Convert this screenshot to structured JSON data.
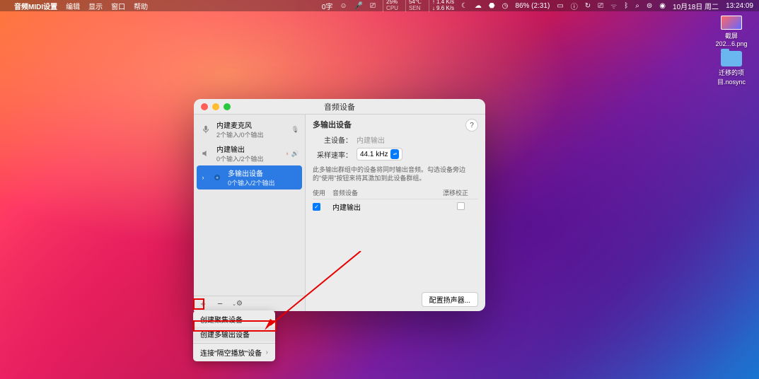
{
  "menubar": {
    "app_name": "音频MIDI设置",
    "items": [
      "编辑",
      "显示",
      "窗口",
      "帮助"
    ],
    "right": {
      "word_count": "0字",
      "cpu": {
        "pct": "25%",
        "label": "CPU"
      },
      "temp": {
        "value": "54℃",
        "label": "SEN"
      },
      "net": {
        "up": "↑ 1.4 K/s",
        "down": "↓ 9.6 K/s"
      },
      "battery": "86% (2:31)",
      "date": "10月18日 周二",
      "time": "13:24:09"
    }
  },
  "desktop": {
    "icon1": {
      "line1": "截屏",
      "line2": "202...6.png"
    },
    "icon2": {
      "line1": "迁移的项",
      "line2": "目.nosync"
    }
  },
  "window": {
    "title": "音频设备",
    "devices": [
      {
        "name": "内建麦克风",
        "sub": "2个输入/0个输出",
        "icon": "mic"
      },
      {
        "name": "内建输出",
        "sub": "0个输入/2个输出",
        "icon": "speaker",
        "badges": true
      },
      {
        "name": "多输出设备",
        "sub": "0个输入/2个输出",
        "icon": "multi",
        "selected": true
      }
    ],
    "content": {
      "title": "多输出设备",
      "main_device_label": "主设备：",
      "main_device_value": "内建输出",
      "sample_rate_label": "采样速率：",
      "sample_rate_value": "44.1 kHz",
      "description": "此多输出群组中的设备将同时输出音频。勾选设备旁边的\"使用\"按钮来将其激加到此设备群组。",
      "headers": {
        "use": "使用",
        "device": "音频设备",
        "drift": "漂移校正"
      },
      "rows": [
        {
          "checked": true,
          "name": "内建输出",
          "drift": false
        }
      ],
      "config_button": "配置扬声器...",
      "help": "?"
    }
  },
  "popup": {
    "item1": "创建聚集设备",
    "item2": "创建多输出设备",
    "item3": "连接\"隔空播放\"设备"
  }
}
